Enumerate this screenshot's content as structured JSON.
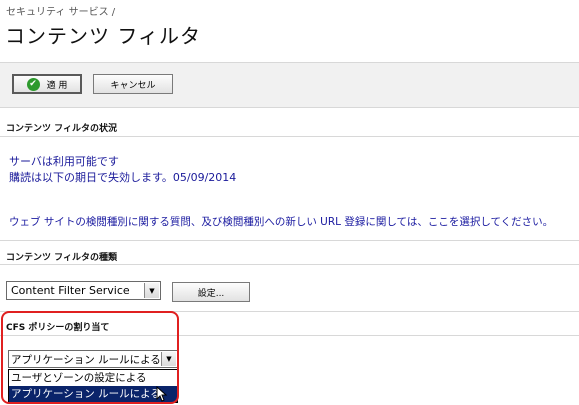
{
  "breadcrumb": "セキュリティ サービス /",
  "page_title": "コンテンツ フィルタ",
  "toolbar": {
    "apply_label": "適 用",
    "cancel_label": "キャンセル"
  },
  "status_section": {
    "heading": "コンテンツ フィルタの状況",
    "server_status": "サーバは利用可能です",
    "subscription_expiry": "購読は以下の期日で失効します。05/09/2014",
    "link_text": "ウェブ サイトの検閲種別に関する質問、及び検閲種別への新しい URL 登録に関しては、ここを選択してください。"
  },
  "type_section": {
    "heading": "コンテンツ フィルタの種類",
    "selected_value": "Content Filter Service",
    "settings_label": "設定..."
  },
  "policy_section": {
    "heading": "CFS ポリシーの割り当て",
    "selected_value": "アプリケーション ルールによる",
    "options": [
      "ユーザとゾーンの設定による",
      "アプリケーション ルールによる"
    ],
    "highlighted_option_index": 1
  },
  "colors": {
    "highlight_border": "#e02020",
    "link_text": "#1a1aa0",
    "selected_option_bg": "#0a246a",
    "apply_check": "#2e9a2e"
  }
}
